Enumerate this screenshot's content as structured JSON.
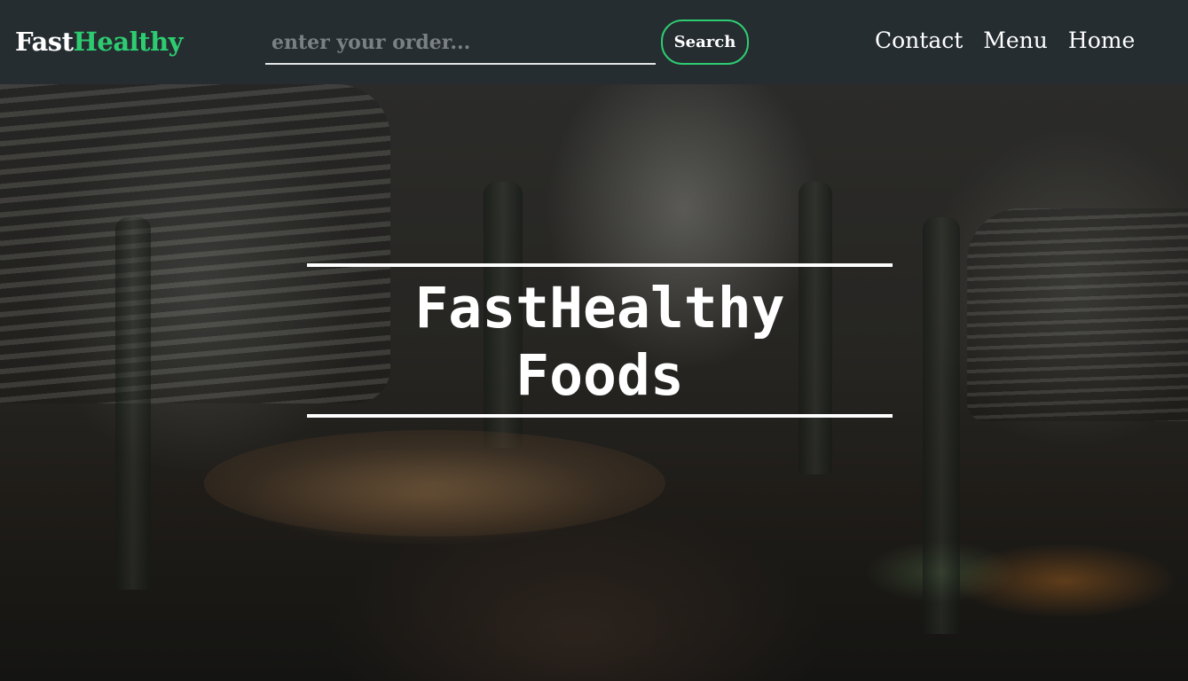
{
  "navbar": {
    "brand_part1": "Fast",
    "brand_part2": "Healthy",
    "search_placeholder": "enter your order...",
    "search_value": "",
    "search_button": "Search",
    "links": [
      {
        "label": "Contact"
      },
      {
        "label": "Menu"
      },
      {
        "label": "Home"
      }
    ]
  },
  "hero": {
    "title_line1": "FastHealthy",
    "title_line2": "Foods"
  },
  "colors": {
    "navbar_bg": "#252d31",
    "accent": "#2ecc71",
    "text": "#ffffff"
  }
}
